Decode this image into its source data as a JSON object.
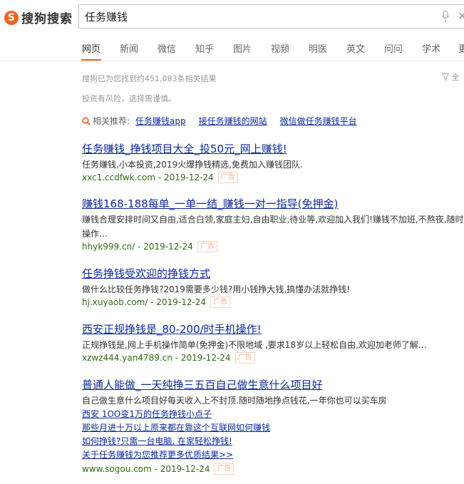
{
  "header": {
    "logo_mark": "S",
    "logo_text": "搜狗搜索",
    "query": "任务赚钱"
  },
  "tabs": [
    {
      "label": "网页"
    },
    {
      "label": "新闻"
    },
    {
      "label": "微信"
    },
    {
      "label": "知乎"
    },
    {
      "label": "图片"
    },
    {
      "label": "视频"
    },
    {
      "label": "明医"
    },
    {
      "label": "英文"
    },
    {
      "label": "问问"
    },
    {
      "label": "学术"
    },
    {
      "label": "更"
    }
  ],
  "stats": "搜狗已为您找到约451,083条相关结果",
  "filter_label": "全",
  "notice": "投资有风险，选择需谨慎。",
  "related": {
    "label": "相关推荐:",
    "links": [
      "任务赚钱app",
      "接任务赚钱的网站",
      "微信做任务赚钱平台"
    ]
  },
  "ad_label": "广告",
  "results": [
    {
      "title": "任务赚钱_挣钱项目大全_投50元_网上赚钱!",
      "desc": "任务赚钱,小本投资,2019火爆挣钱精选,免费加入赚钱团队.",
      "url": "xxc1.ccdfwk.com - 2019-12-24"
    },
    {
      "title": "赚钱168-188每单_一单一结_赚钱一对一指导(免押金)",
      "desc": "赚钱合理安排时间又自由,适合白领,家庭主妇,自由职业,待业等,欢迎加入我们!赚钱不加班,不熬夜,随时操作…",
      "url": "hhyk999.cn/ - 2019-12-24"
    },
    {
      "title": "任务挣钱受欢迎的挣钱方式",
      "desc": "做什么比较任务挣钱?2019需要多少钱?用小钱挣大钱,搞懂办法就挣钱!",
      "url": "hj.xuyaob.com/ - 2019-12-24"
    },
    {
      "title": "西安正规挣钱是_80-200/时手机操作!",
      "desc": "正规挣钱是,网上手机操作简单(免押金)不限地域 ,要求18岁以上轻松自由,欢迎加老师了解…",
      "url": "xzwz444.yan4789.cn - 2019-12-24"
    },
    {
      "title": "普通人能做_一天纯挣三五百自己做生意什么项目好",
      "desc": "自己做生意什么项目好每天收入上不封顶.随时随地挣点钱花,一年你也可以买车房",
      "sub_links": [
        "西安 1OO变1万的任务挣钱小点子",
        "那些月进十万以上原来都在靠这个互联网如何赚钱",
        "如何挣钱?只需一台电脑, 在家轻松挣钱!",
        "关于任务赚钱为您推荐更多优质结果>>"
      ],
      "url": "www.sogou.com - 2019-12-24"
    }
  ]
}
